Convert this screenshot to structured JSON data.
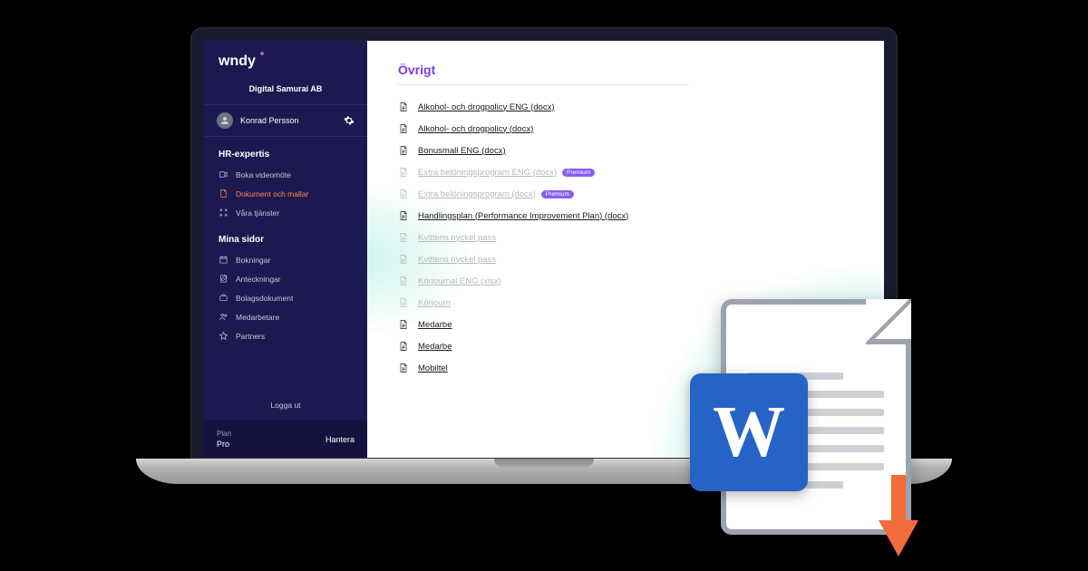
{
  "brand": "wndy",
  "company": "Digital Samurai AB",
  "user": {
    "name": "Konrad Persson"
  },
  "sidebar": {
    "section1_title": "HR-expertis",
    "section2_title": "Mina sidor",
    "items1": [
      {
        "label": "Boka videomöte"
      },
      {
        "label": "Dokument och mallar"
      },
      {
        "label": "Våra tjänster"
      }
    ],
    "items2": [
      {
        "label": "Bokningar"
      },
      {
        "label": "Anteckningar"
      },
      {
        "label": "Bolagsdokument"
      },
      {
        "label": "Medarbetare"
      },
      {
        "label": "Partners"
      }
    ],
    "logout": "Logga ut",
    "plan_label": "Plan",
    "plan_value": "Pro",
    "manage": "Hantera"
  },
  "main": {
    "title": "Övrigt",
    "docs": [
      {
        "label": "Alkohol- och drogpolicy ENG (docx)",
        "muted": false,
        "premium": false
      },
      {
        "label": "Alkohol- och drogpolicy (docx)",
        "muted": false,
        "premium": false
      },
      {
        "label": "Bonusmall ENG (docx)",
        "muted": false,
        "premium": false
      },
      {
        "label": "Extra belöningsprogram ENG (docx)",
        "muted": true,
        "premium": true
      },
      {
        "label": "Extra belöningsprogram (docx)",
        "muted": true,
        "premium": true
      },
      {
        "label": "Handlingsplan (Performance Improvement Plan) (docx)",
        "muted": false,
        "premium": false
      },
      {
        "label": "Kvittens nyckel    pass",
        "muted": true,
        "premium": false
      },
      {
        "label": "Kvittens nyckel    pass",
        "muted": true,
        "premium": false
      },
      {
        "label": "Körjournal ENG (xlsx)",
        "muted": true,
        "premium": false
      },
      {
        "label": "Körjourn",
        "muted": true,
        "premium": false
      },
      {
        "label": "Medarbe",
        "muted": false,
        "premium": false
      },
      {
        "label": "Medarbe",
        "muted": false,
        "premium": false
      },
      {
        "label": "Mobiltel",
        "muted": false,
        "premium": false
      }
    ],
    "premium_badge": "Premium"
  }
}
